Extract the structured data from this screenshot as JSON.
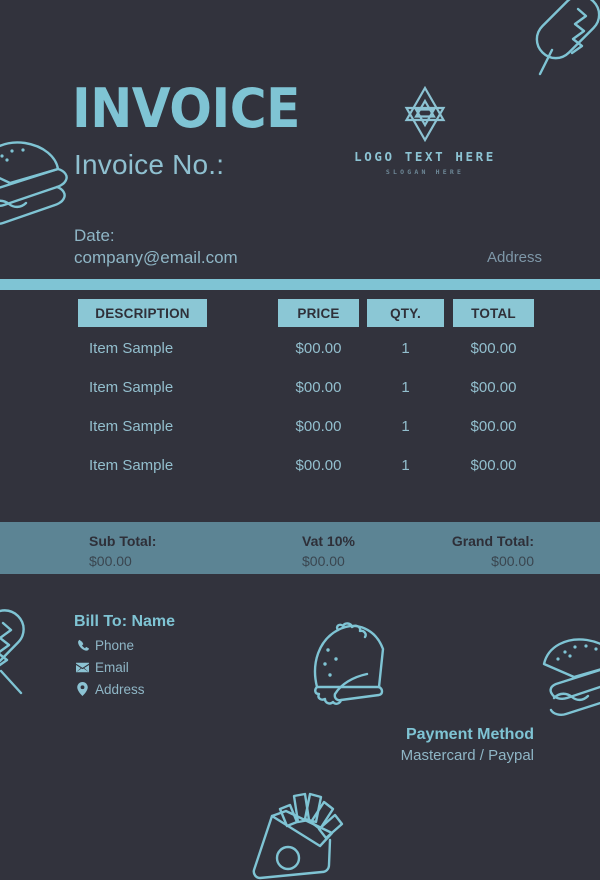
{
  "theme": {
    "background": "#32333d",
    "accent_teal": "#7fc4d4",
    "header_cell_fill": "#8bc7d5",
    "body_text": "#9ab8c4",
    "totals_band": "#5c8494",
    "totals_text": "#2e2f38"
  },
  "header": {
    "title": "INVOICE",
    "invoice_no_label": "Invoice No.:",
    "date_label": "Date:",
    "email": "company@email.com",
    "address_label": "Address"
  },
  "logo": {
    "mark": "six-pointed-star-icon",
    "text": "LOGO TEXT HERE",
    "slogan": "SLOGAN HERE"
  },
  "table": {
    "columns": [
      "DESCRIPTION",
      "PRICE",
      "QTY.",
      "TOTAL"
    ],
    "rows": [
      {
        "description": "Item Sample",
        "price": "$00.00",
        "qty": "1",
        "total": "$00.00"
      },
      {
        "description": "Item Sample",
        "price": "$00.00",
        "qty": "1",
        "total": "$00.00"
      },
      {
        "description": "Item Sample",
        "price": "$00.00",
        "qty": "1",
        "total": "$00.00"
      },
      {
        "description": "Item Sample",
        "price": "$00.00",
        "qty": "1",
        "total": "$00.00"
      }
    ]
  },
  "totals": {
    "sub_total_label": "Sub Total:",
    "sub_total_value": "$00.00",
    "vat_label": "Vat 10%",
    "vat_value": "$00.00",
    "grand_total_label": "Grand Total:",
    "grand_total_value": "$00.00"
  },
  "bill_to": {
    "title": "Bill To: Name",
    "contacts": [
      {
        "icon": "phone-icon",
        "label": "Phone"
      },
      {
        "icon": "envelope-icon",
        "label": "Email"
      },
      {
        "icon": "map-pin-icon",
        "label": "Address"
      }
    ]
  },
  "payment": {
    "title": "Payment Method",
    "methods": "Mastercard / Paypal"
  },
  "decorations": [
    {
      "name": "corn-dog-illustration",
      "position": "top-right"
    },
    {
      "name": "burger-illustration",
      "position": "top-left"
    },
    {
      "name": "corn-dog-illustration",
      "position": "middle-left"
    },
    {
      "name": "taco-illustration",
      "position": "bottom-center"
    },
    {
      "name": "burger-illustration",
      "position": "bottom-right"
    },
    {
      "name": "fries-illustration",
      "position": "bottom-center-low"
    }
  ]
}
